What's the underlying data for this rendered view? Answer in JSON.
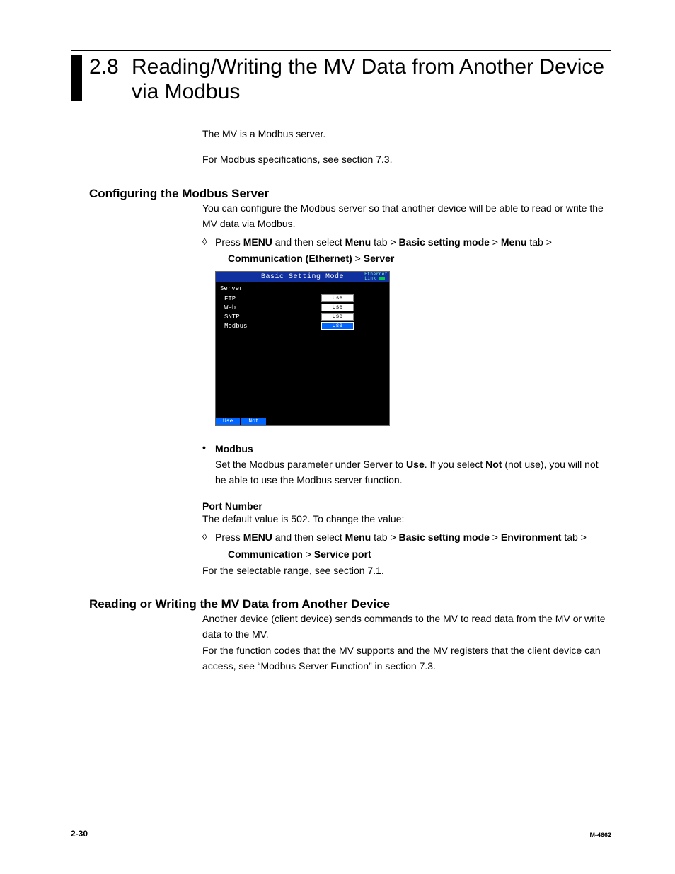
{
  "section": {
    "number": "2.8",
    "title": "Reading/Writing the MV Data from Another Device via Modbus"
  },
  "intro": {
    "line1": "The MV is a Modbus server.",
    "line2": "For Modbus specifications, see section 7.3."
  },
  "config": {
    "heading": "Configuring the Modbus Server",
    "para": "You can configure the Modbus server so that another device will be able to read or write the MV data via Modbus.",
    "press": "Press ",
    "menu": "MENU",
    "andthen": " and then select ",
    "menu_tab": "Menu",
    "tab_word": " tab > ",
    "bsm": "Basic setting mode",
    "gt": " > ",
    "comm_eth": "Communication (Ethernet)",
    "server": "Server"
  },
  "device": {
    "title": "Basic Setting Mode",
    "eth_label": "Ethernet\nLink",
    "group": "Server",
    "rows": [
      {
        "label": "FTP",
        "value": "Use",
        "selected": false
      },
      {
        "label": "Web",
        "value": "Use",
        "selected": false
      },
      {
        "label": "SNTP",
        "value": "Use",
        "selected": false
      },
      {
        "label": "Modbus",
        "value": "Use",
        "selected": true
      }
    ],
    "btn_use": "Use",
    "btn_not": "Not"
  },
  "modbus_bullet": {
    "title": "Modbus",
    "para_a": "Set the Modbus parameter under Server to ",
    "use": "Use",
    "para_b": ". If you select ",
    "not": "Not",
    "para_c": " (not use), you will not be able to use the Modbus server function."
  },
  "port": {
    "heading": "Port Number",
    "default_line": "The default value is 502. To change the value:",
    "press": "Press ",
    "menu": "MENU",
    "andthen": " and then select ",
    "menu_tab": "Menu",
    "tab_word": " tab > ",
    "bsm": "Basic setting mode",
    "gt": " > ",
    "env": "Environment",
    "comm": "Communication",
    "svcport": "Service port",
    "range_line": "For the selectable range, see section 7.1."
  },
  "rw": {
    "heading": "Reading or Writing the MV Data from Another Device",
    "p1": "Another device (client device) sends commands to the MV to read data from the MV or write data to the MV.",
    "p2": "For the function codes that the MV supports and the MV registers that the client device can access, see “Modbus Server Function” in section 7.3."
  },
  "footer": {
    "page": "2-30",
    "docid": "M-4662"
  }
}
